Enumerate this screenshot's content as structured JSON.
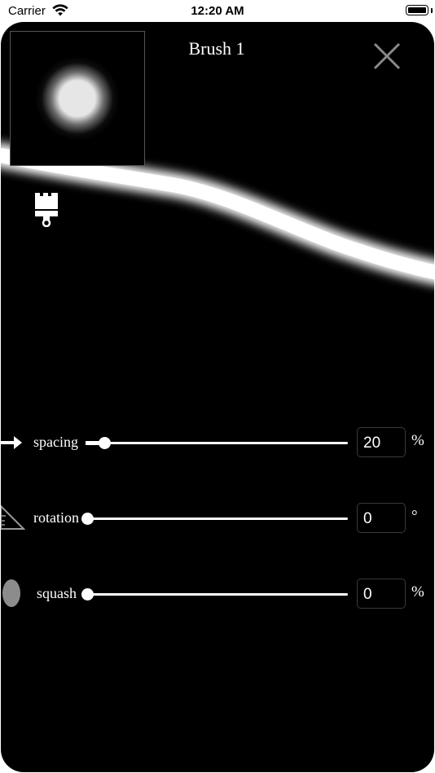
{
  "status_bar": {
    "carrier": "Carrier",
    "time": "12:20 AM",
    "icons": [
      "wifi-icon",
      "battery-icon"
    ]
  },
  "header": {
    "title": "Brush 1",
    "close_icon": "close-icon"
  },
  "tool_icon": "paint-brush-icon",
  "settings": {
    "spacing": {
      "label": "spacing",
      "value": "20",
      "unit": "%",
      "slider_level": 0.07,
      "icon": "spacing-arrow-icon"
    },
    "rotation": {
      "label": "rotation",
      "value": "0",
      "unit": "°",
      "slider_level": 0.0,
      "icon": "rotation-triangle-icon"
    },
    "squash": {
      "label": "squash",
      "value": "0",
      "unit": "%",
      "slider_level": 0.0,
      "icon": "squash-ellipse-icon"
    }
  },
  "colors": {
    "sheet_background": "#000000",
    "foreground": "#ffffff",
    "close_icon": "#8a8a8a"
  }
}
